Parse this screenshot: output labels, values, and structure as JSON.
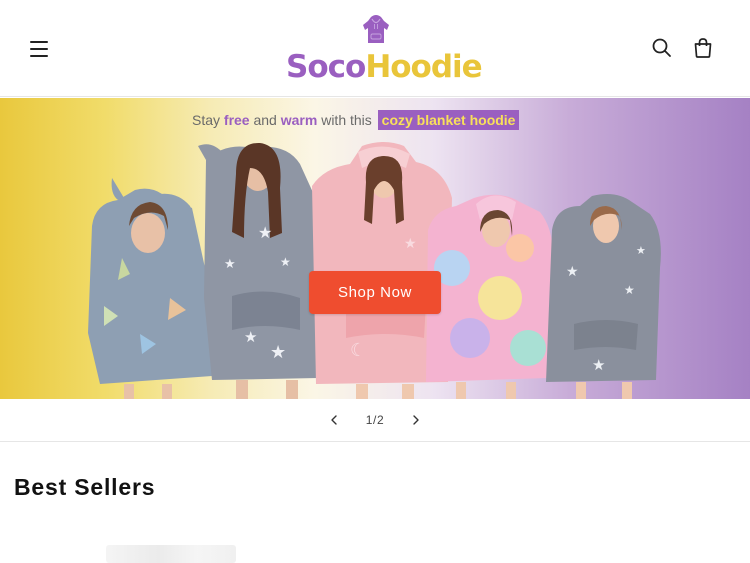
{
  "header": {
    "menu_icon": "hamburger-menu-icon",
    "logo": {
      "word1": "Soco",
      "word2": "Hoodie",
      "mark_icon": "hoodie-icon",
      "color1": "#9a5fc0",
      "color2": "#e9c53a"
    },
    "search_icon": "search-icon",
    "cart_icon": "cart-icon"
  },
  "banner": {
    "tagline": {
      "part1": "Stay ",
      "bold1": "free",
      "part2": " and ",
      "bold2": "warm",
      "part3": " with this ",
      "highlight": "cozy blanket hoodie"
    },
    "cta_label": "Shop Now",
    "cta_color": "#ef4d2f"
  },
  "slider": {
    "prev_icon": "chevron-left-icon",
    "next_icon": "chevron-right-icon",
    "counter": "1/2"
  },
  "best_sellers": {
    "title": "Best Sellers"
  }
}
